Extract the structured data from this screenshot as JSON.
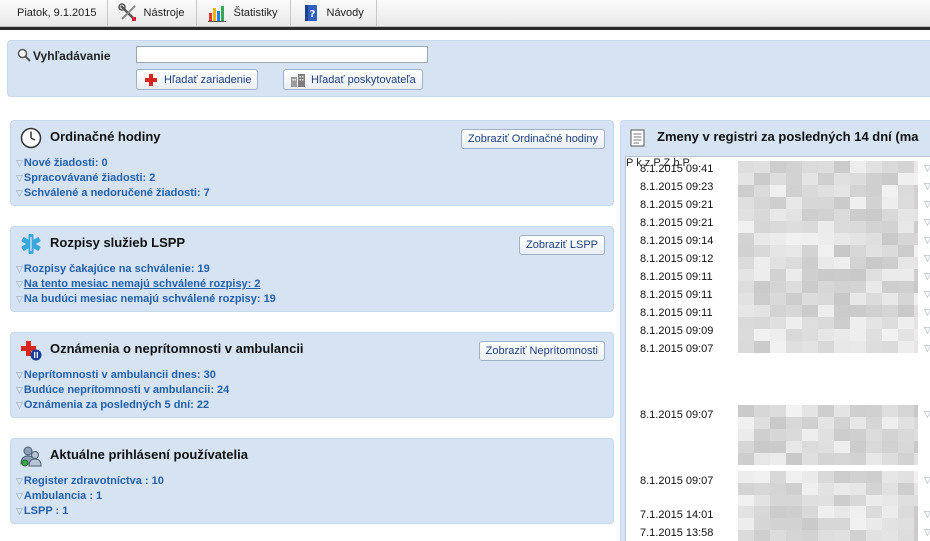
{
  "toolbar": {
    "date": "Piatok, 9.1.2015",
    "items": [
      {
        "label": "Nástroje",
        "icon": "tools-icon"
      },
      {
        "label": "Štatistiky",
        "icon": "statistics-chart-icon"
      },
      {
        "label": "Návody",
        "icon": "help-book-icon"
      }
    ]
  },
  "search": {
    "label": "Vyhľadávanie",
    "value": "",
    "find_facility_label": "Hľadať zariadenie",
    "find_provider_label": "Hľadať poskytovateľa"
  },
  "panels": {
    "ordinacne": {
      "title": "Ordinačné hodiny",
      "button": "Zobraziť Ordinačné hodiny",
      "items": [
        "Nové žiadosti: 0",
        "Spracovávané žiadosti: 2",
        "Schválené a nedoručené žiadosti: 7"
      ]
    },
    "lspp": {
      "title": "Rozpisy služieb LSPP",
      "button": "Zobraziť LSPP",
      "items": [
        "Rozpisy čakajúce na schválenie: 19",
        "Na tento mesiac nemajú schválené rozpisy: 2",
        "Na budúci mesiac nemajú schválené rozpisy: 19"
      ]
    },
    "nepritomnost": {
      "title": "Oznámenia o neprítomnosti v ambulancii",
      "button": "Zobraziť Neprítomnosti",
      "items": [
        "Neprítomnosti v ambulancii dnes: 30",
        "Budúce neprítomnosti v ambulancii: 24",
        "Oznámenia za posledných 5 dní: 22"
      ]
    },
    "users": {
      "title": "Aktuálne prihlásení používatelia",
      "items": [
        "Register zdravotníctva : 10",
        "Ambulancia : 1",
        "LSPP : 1"
      ]
    }
  },
  "changes": {
    "title": "Zmeny v registri za posledných 14 dní (ma",
    "timestamps": [
      "8.1.2015 09:41",
      "8.1.2015 09:23",
      "8.1.2015 09:21",
      "8.1.2015 09:21",
      "8.1.2015 09:14",
      "8.1.2015 09:12",
      "8.1.2015 09:11",
      "8.1.2015 09:11",
      "8.1.2015 09:11",
      "8.1.2015 09:09",
      "8.1.2015 09:07",
      "8.1.2015 09:07",
      "8.1.2015 09:07",
      "7.1.2015 14:01",
      "7.1.2015 13:58"
    ],
    "side_fragments": [
      "P",
      "k",
      "z",
      "P",
      "Z",
      "b",
      "P"
    ]
  },
  "colors": {
    "panel_bg": "#d5e3f3",
    "link": "#2060a8"
  }
}
